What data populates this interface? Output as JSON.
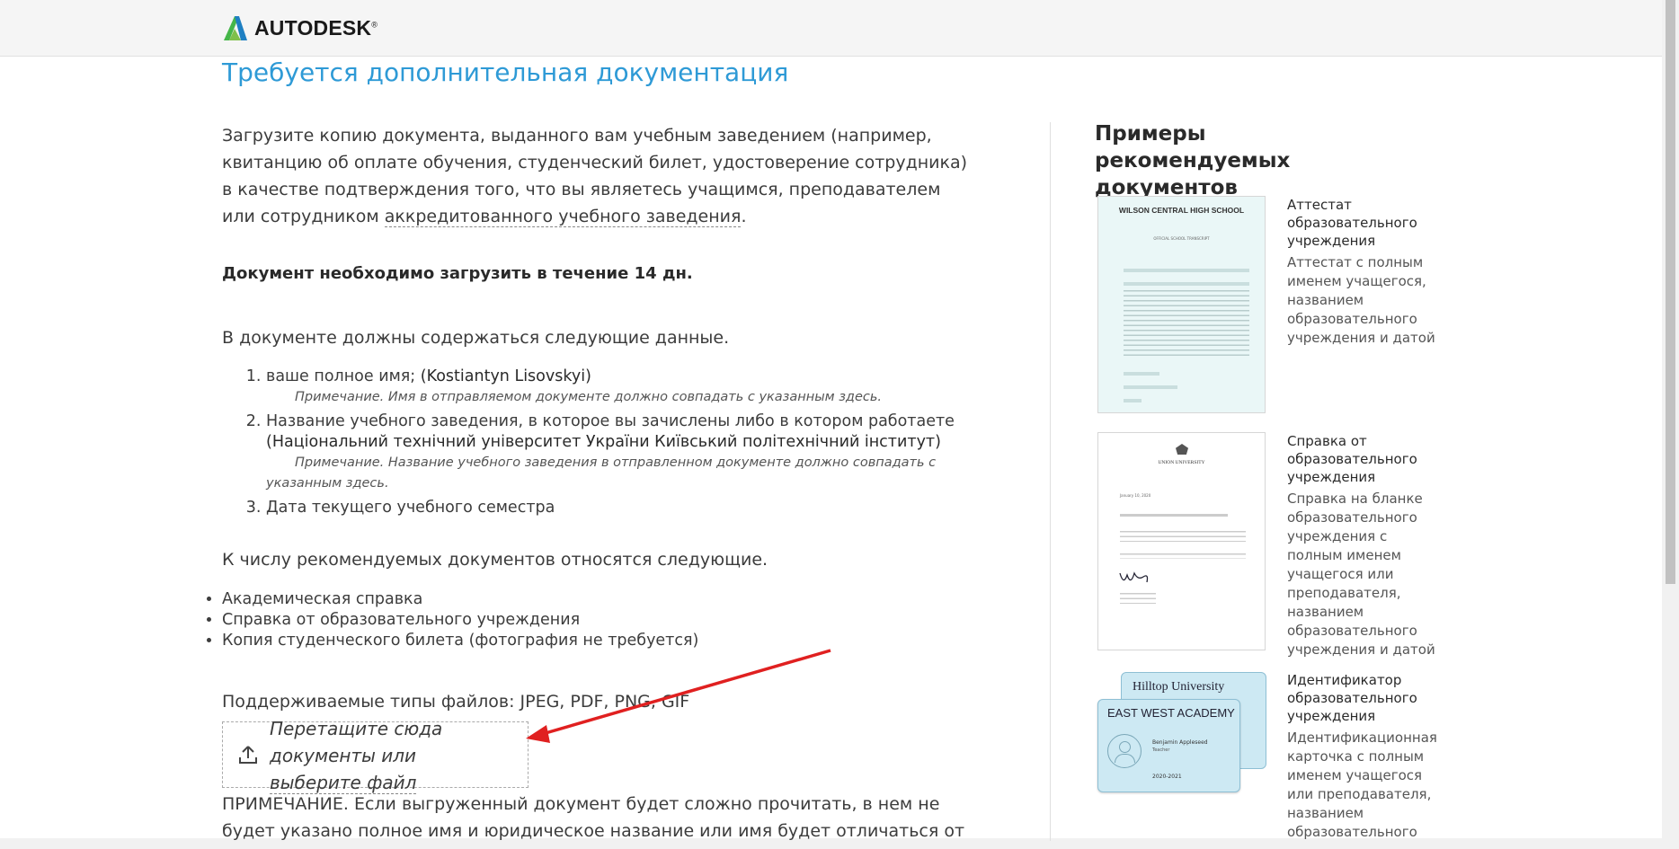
{
  "header": {
    "logo_text": "AUTODESK",
    "logo_mark": "®"
  },
  "main": {
    "title": "Требуется дополнительная документация",
    "intro_before": "Загрузите копию документа, выданного вам учебным заведением (например, квитанцию об оплате обучения, студенческий билет, удостоверение сотрудника) в качестве подтверждения того, что вы являетесь учащимся, преподавателем или сотрудником ",
    "intro_link": "аккредитованного учебного заведения",
    "intro_after": ".",
    "deadline": "Документ необходимо загрузить в течение 14 дн.",
    "must_contain": "В документе должны содержаться следующие данные.",
    "requirements": [
      {
        "label": "ваше полное имя;",
        "value": "(Kostiantyn Lisovskyi)",
        "note": "Примечание. Имя в отправляемом документе должно совпадать с указанным здесь."
      },
      {
        "label": "Название учебного заведения, в которое вы зачислены либо в котором работаете",
        "value": "(Національний технічний університет України Київський політехнічний інститут)",
        "note": "Примечание. Название учебного заведения в отправленном документе должно совпадать с указанным здесь."
      },
      {
        "label": "Дата текущего учебного семестра",
        "value": "",
        "note": ""
      }
    ],
    "recommended_intro": "К числу рекомендуемых документов относятся следующие.",
    "recommended_docs": [
      "Академическая справка",
      "Справка от образовательного учреждения",
      "Копия студенческого билета (фотография не требуется)"
    ],
    "file_types": "Поддерживаемые типы файлов: JPEG, PDF, PNG, GIF",
    "dropzone": {
      "text": "Перетащите сюда документы или ",
      "link": "выберите файл"
    },
    "footnote": "ПРИМЕЧАНИЕ. Если выгруженный документ будет сложно прочитать, в нем не будет указано полное имя и юридическое название или имя будет отличаться от"
  },
  "sidebar": {
    "title": "Примеры рекомендуемых документов",
    "samples": [
      {
        "name": "Аттестат образовательного учреждения",
        "desc": "Аттестат с полным именем учащегося, названием образовательного учреждения и датой",
        "image_heading": "WILSON CENTRAL HIGH SCHOOL",
        "image_sub": "OFFICIAL SCHOOL TRANSCRIPT"
      },
      {
        "name": "Справка от образовательного учреждения",
        "desc": "Справка на бланке образовательного учреждения с полным именем учащегося или преподавателя, названием образовательного учреждения и датой",
        "image_heading": "UNION UNIVERSITY",
        "image_date": "January 10, 2020"
      },
      {
        "name": "Идентификатор образовательного учреждения",
        "desc": "Идентификационная карточка с полным именем учащегося или преподавателя, названием образовательного",
        "back_card": "Hilltop University",
        "front_card": "EAST WEST ACADEMY",
        "holder": "Benjamin Appleseed",
        "holder_role": "Teacher",
        "years": "2020-2021"
      }
    ]
  },
  "colors": {
    "accent": "#2e9ad6",
    "arrow": "#e02020"
  }
}
